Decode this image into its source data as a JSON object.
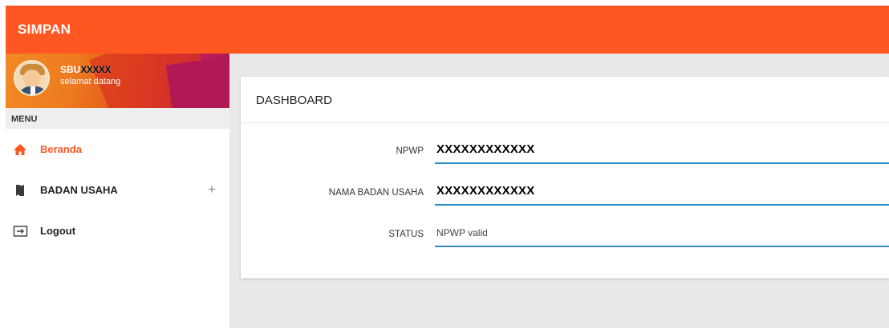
{
  "app": {
    "title": "SIMPAN"
  },
  "user": {
    "name_prefix": "SBU",
    "name_masked": "XXXXX",
    "greeting": "selamat datang"
  },
  "sidebar": {
    "menu_header": "MENU",
    "items": [
      {
        "label": "Beranda",
        "icon": "home-icon",
        "active": true
      },
      {
        "label": "BADAN USAHA",
        "icon": "book-icon",
        "expand": "+"
      },
      {
        "label": "Logout",
        "icon": "logout-icon"
      }
    ]
  },
  "dashboard": {
    "title": "DASHBOARD",
    "fields": [
      {
        "label": "NPWP",
        "value": "XXXXXXXXXXXX"
      },
      {
        "label": "NAMA BADAN USAHA",
        "value": "XXXXXXXXXXXX"
      },
      {
        "label": "STATUS",
        "value": "NPWP valid"
      }
    ]
  },
  "colors": {
    "primary": "#ff5722",
    "underline": "#2e89c9",
    "background": "#e9e9e9"
  }
}
